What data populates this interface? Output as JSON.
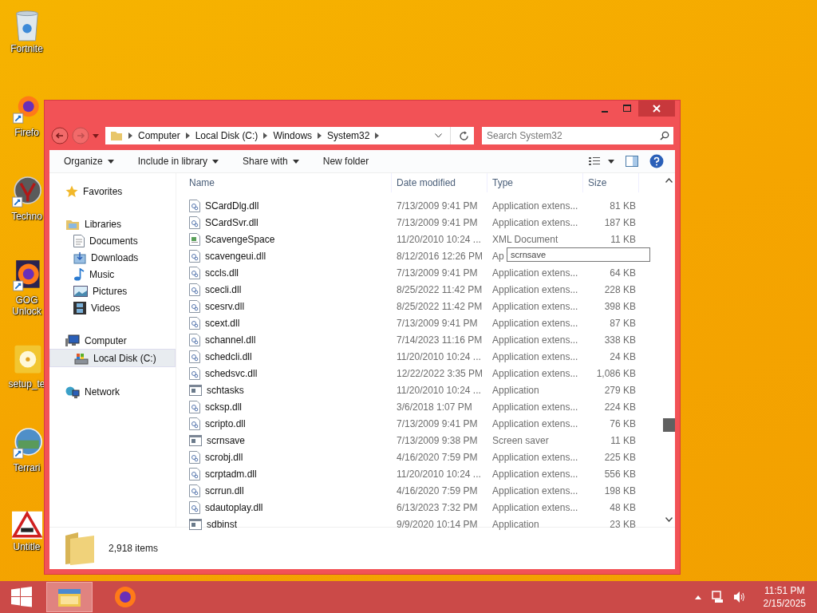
{
  "desktop_icons": [
    {
      "kind": "recycle",
      "lines": [
        "Fortnite"
      ]
    },
    {
      "kind": "firefox",
      "lines": [
        "Firefo"
      ]
    },
    {
      "kind": "game",
      "lines": [
        "Techno"
      ]
    },
    {
      "kind": "gog",
      "lines": [
        "GOG",
        "Unlock"
      ]
    },
    {
      "kind": "disc",
      "lines": [
        "setup_te"
      ]
    },
    {
      "kind": "terraria",
      "lines": [
        "Terrari"
      ]
    },
    {
      "kind": "test",
      "lines": [
        "Untitle"
      ]
    }
  ],
  "window": {
    "address": {
      "crumbs": [
        "Computer",
        "Local Disk (C:)",
        "Windows",
        "System32"
      ]
    },
    "search": {
      "placeholder": "Search System32"
    },
    "toolbar": [
      {
        "label": "Organize",
        "dropdown": true
      },
      {
        "label": "Include in library",
        "dropdown": true
      },
      {
        "label": "Share with",
        "dropdown": true
      },
      {
        "label": "New folder",
        "dropdown": false
      }
    ],
    "nav": [
      {
        "kind": "favorites",
        "label": "Favorites",
        "selected": false
      },
      {
        "kind": "libraries",
        "label": "Libraries",
        "selected": false,
        "children": [
          {
            "kind": "documents",
            "label": "Documents",
            "selected": false
          },
          {
            "kind": "downloads",
            "label": "Downloads",
            "selected": false
          },
          {
            "kind": "music",
            "label": "Music",
            "selected": false
          },
          {
            "kind": "pictures",
            "label": "Pictures",
            "selected": false
          },
          {
            "kind": "videos",
            "label": "Videos",
            "selected": false
          }
        ]
      },
      {
        "kind": "computer",
        "label": "Computer",
        "selected": false,
        "children": [
          {
            "kind": "disk",
            "label": "Local Disk (C:)",
            "selected": true
          }
        ]
      },
      {
        "kind": "network",
        "label": "Network",
        "selected": false
      }
    ],
    "columns": [
      "Name",
      "Date modified",
      "Type",
      "Size"
    ],
    "rows": [
      {
        "kind": "dll",
        "name": "SCardDlg.dll",
        "date": "7/13/2009 9:41 PM",
        "type": "Application extens...",
        "size": "81 KB"
      },
      {
        "kind": "dll",
        "name": "SCardSvr.dll",
        "date": "7/13/2009 9:41 PM",
        "type": "Application extens...",
        "size": "187 KB"
      },
      {
        "kind": "xml",
        "name": "ScavengeSpace",
        "date": "11/20/2010 10:24 ...",
        "type": "XML Document",
        "size": "11 KB"
      },
      {
        "kind": "dll",
        "name": "scavengeui.dll",
        "date": "8/12/2016 12:26 PM",
        "type": "Ap"
      },
      {
        "kind": "dll",
        "name": "sccls.dll",
        "date": "7/13/2009 9:41 PM",
        "type": "Application extens...",
        "size": "64 KB"
      },
      {
        "kind": "dll",
        "name": "scecli.dll",
        "date": "8/25/2022 11:42 PM",
        "type": "Application extens...",
        "size": "228 KB"
      },
      {
        "kind": "dll",
        "name": "scesrv.dll",
        "date": "8/25/2022 11:42 PM",
        "type": "Application extens...",
        "size": "398 KB"
      },
      {
        "kind": "dll",
        "name": "scext.dll",
        "date": "7/13/2009 9:41 PM",
        "type": "Application extens...",
        "size": "87 KB"
      },
      {
        "kind": "dll",
        "name": "schannel.dll",
        "date": "7/14/2023 11:16 PM",
        "type": "Application extens...",
        "size": "338 KB"
      },
      {
        "kind": "dll",
        "name": "schedcli.dll",
        "date": "11/20/2010 10:24 ...",
        "type": "Application extens...",
        "size": "24 KB"
      },
      {
        "kind": "dll",
        "name": "schedsvc.dll",
        "date": "12/22/2022 3:35 PM",
        "type": "Application extens...",
        "size": "1,086 KB"
      },
      {
        "kind": "exe",
        "name": "schtasks",
        "date": "11/20/2010 10:24 ...",
        "type": "Application",
        "size": "279 KB"
      },
      {
        "kind": "dll",
        "name": "scksp.dll",
        "date": "3/6/2018 1:07 PM",
        "type": "Application extens...",
        "size": "224 KB"
      },
      {
        "kind": "dll",
        "name": "scripto.dll",
        "date": "7/13/2009 9:41 PM",
        "type": "Application extens...",
        "size": "76 KB"
      },
      {
        "kind": "exe",
        "name": "scrnsave",
        "date": "7/13/2009 9:38 PM",
        "type": "Screen saver",
        "size": "11 KB"
      },
      {
        "kind": "dll",
        "name": "scrobj.dll",
        "date": "4/16/2020 7:59 PM",
        "type": "Application extens...",
        "size": "225 KB"
      },
      {
        "kind": "dll",
        "name": "scrptadm.dll",
        "date": "11/20/2010 10:24 ...",
        "type": "Application extens...",
        "size": "556 KB"
      },
      {
        "kind": "dll",
        "name": "scrrun.dll",
        "date": "4/16/2020 7:59 PM",
        "type": "Application extens...",
        "size": "198 KB"
      },
      {
        "kind": "dll",
        "name": "sdautoplay.dll",
        "date": "6/13/2023 7:32 PM",
        "type": "Application extens...",
        "size": "48 KB"
      },
      {
        "kind": "exe",
        "name": "sdbinst",
        "date": "9/9/2020 10:14 PM",
        "type": "Application",
        "size": "23 KB"
      }
    ],
    "tooltip": "scrnsave",
    "status": "2,918 items"
  },
  "taskbar": {
    "apps": [
      {
        "kind": "explorer",
        "selected": true
      },
      {
        "kind": "firefox",
        "selected": false
      }
    ],
    "time": "11:51 PM",
    "date": "2/15/2025"
  }
}
